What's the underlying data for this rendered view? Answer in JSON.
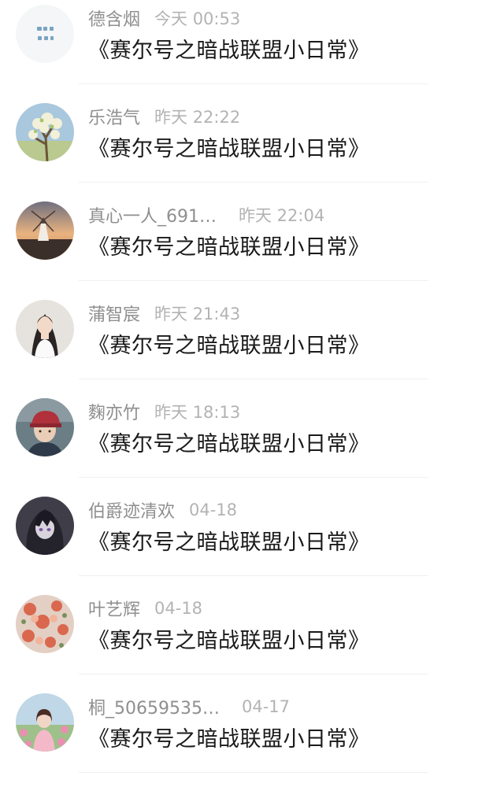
{
  "comments": [
    {
      "name": "德含烟",
      "time": "今天 00:53",
      "message": "《赛尔号之暗战联盟小日常》",
      "avatar": "avatar-calligraphy-icon"
    },
    {
      "name": "乐浩气",
      "time": "昨天 22:22",
      "message": "《赛尔号之暗战联盟小日常》",
      "avatar": "avatar-blossom-tree-icon"
    },
    {
      "name": "真心一人_691…",
      "time": "昨天 22:04",
      "message": "《赛尔号之暗战联盟小日常》",
      "avatar": "avatar-windmill-icon"
    },
    {
      "name": "蒲智宸",
      "time": "昨天 21:43",
      "message": "《赛尔号之暗战联盟小日常》",
      "avatar": "avatar-girl-portrait-icon"
    },
    {
      "name": "麴亦竹",
      "time": "昨天 18:13",
      "message": "《赛尔号之暗战联盟小日常》",
      "avatar": "avatar-red-cap-person-icon"
    },
    {
      "name": "伯爵迹清欢",
      "time": "04-18",
      "message": "《赛尔号之暗战联盟小日常》",
      "avatar": "avatar-anime-girl-icon"
    },
    {
      "name": "叶艺辉",
      "time": "04-18",
      "message": "《赛尔号之暗战联盟小日常》",
      "avatar": "avatar-floral-icon"
    },
    {
      "name": "桐_50659535…",
      "time": "04-17",
      "message": "《赛尔号之暗战联盟小日常》",
      "avatar": "avatar-flower-girl-icon"
    }
  ]
}
